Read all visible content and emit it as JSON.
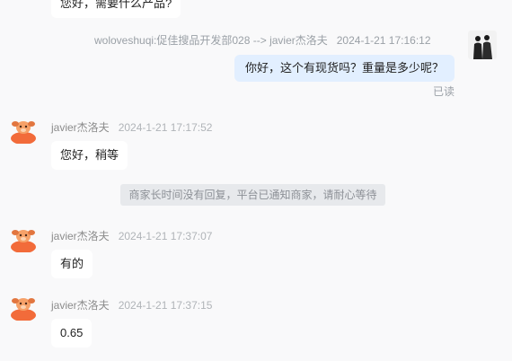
{
  "messages": {
    "top_partial": {
      "text": "您好，需要什么产品?"
    },
    "outgoing": {
      "sender": "woloveshuqi:促佳搜品开发部028 --> javier杰洛夫",
      "time": "2024-1-21 17:16:12",
      "text": "你好，这个有现货吗？重量是多少呢？",
      "status": "已读"
    },
    "incoming": [
      {
        "sender": "javier杰洛夫",
        "time": "2024-1-21 17:17:52",
        "text": "您好，稍等"
      },
      {
        "sender": "javier杰洛夫",
        "time": "2024-1-21 17:37:07",
        "text": "有的"
      },
      {
        "sender": "javier杰洛夫",
        "time": "2024-1-21 17:37:15",
        "text": "0.65"
      }
    ],
    "system_notice": "商家长时间没有回复，平台已通知商家，请耐心等待"
  },
  "colors": {
    "background": "#f9f9fa",
    "outgoing_bubble": "#e2efff",
    "incoming_bubble": "#ffffff",
    "notice_bg": "#e7e9ec",
    "avatar_orange": "#f26b3a"
  },
  "icons": {
    "incoming_avatar": "cartoon-dog-avatar",
    "outgoing_avatar": "user-photo-avatar"
  }
}
